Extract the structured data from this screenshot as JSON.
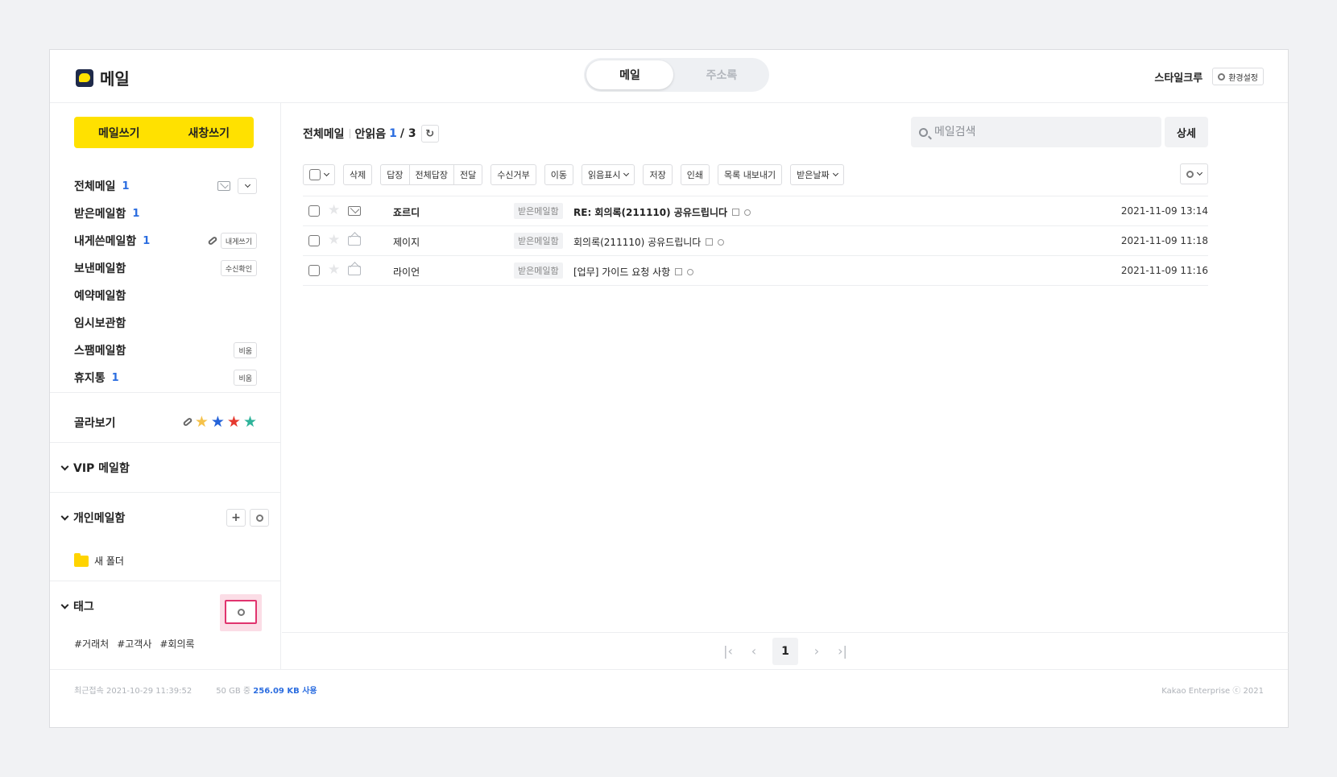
{
  "app": {
    "title": "메일"
  },
  "mode_tabs": [
    {
      "label": "메일",
      "active": true
    },
    {
      "label": "주소록",
      "active": false
    }
  ],
  "top_right": {
    "user_name": "스타일크루",
    "settings_label": "환경설정"
  },
  "compose": {
    "write_label": "메일쓰기",
    "new_window_label": "새창쓰기"
  },
  "mailboxes": [
    {
      "label": "전체메일",
      "count": "1"
    },
    {
      "label": "받은메일함",
      "count": "1"
    },
    {
      "label": "내게쓴메일함",
      "count": "1",
      "action": "내게쓰기"
    },
    {
      "label": "보낸메일함",
      "count": "",
      "action": "수신확인"
    },
    {
      "label": "예약메일함",
      "count": ""
    },
    {
      "label": "임시보관함",
      "count": ""
    },
    {
      "label": "스팸메일함",
      "count": "",
      "action": "비움"
    },
    {
      "label": "휴지통",
      "count": "1",
      "action": "비움"
    }
  ],
  "filter": {
    "label": "골라보기",
    "icons": [
      "attachment-icon",
      "star-yellow-icon",
      "star-blue-icon",
      "star-red-icon",
      "star-green-icon"
    ],
    "colors": {
      "yellow": "#f5c24a",
      "blue": "#2563d9",
      "red": "#e5392f",
      "green": "#2fb39a"
    }
  },
  "sections": {
    "vip": "VIP 메일함",
    "personal": "개인메일함",
    "new_folder": "새 폴더",
    "tag": "태그"
  },
  "tags": [
    "#거래처",
    "#고객사",
    "#회의록"
  ],
  "footer": {
    "last_login": "최근접속 2021-10-29 11:39:52",
    "quota_prefix": "50 GB 중",
    "quota_used": "256.09 KB 사용",
    "copyright": "Kakao Enterprise ⓒ 2021"
  },
  "main": {
    "title": "전체메일",
    "unread_label": "안읽음",
    "unread_count": "1",
    "total_count": "/ 3"
  },
  "search": {
    "placeholder": "메일검색",
    "detail_label": "상세"
  },
  "toolbar": {
    "delete": "삭제",
    "reply": "답장",
    "reply_all": "전체답장",
    "forward": "전달",
    "block": "수신거부",
    "move": "이동",
    "mark_read": "읽음표시",
    "save": "저장",
    "print": "인쇄",
    "export": "목록 내보내기",
    "sort": "받은날짜"
  },
  "mails": [
    {
      "sender": "죠르디",
      "box": "받은메일함",
      "subject": "RE: 회의록(211110) 공유드립니다",
      "date": "2021-11-09 13:14",
      "unread": true
    },
    {
      "sender": "제이지",
      "box": "받은메일함",
      "subject": "회의록(211110) 공유드립니다",
      "date": "2021-11-09 11:18",
      "unread": false
    },
    {
      "sender": "라이언",
      "box": "받은메일함",
      "subject": "[업무] 가이드 요청 사항",
      "date": "2021-11-09 11:16",
      "unread": false
    }
  ],
  "pagination": {
    "current": "1"
  },
  "accent": {
    "yellow": "#ffe100",
    "blue": "#2b6de0",
    "highlight": "#e0336e"
  }
}
